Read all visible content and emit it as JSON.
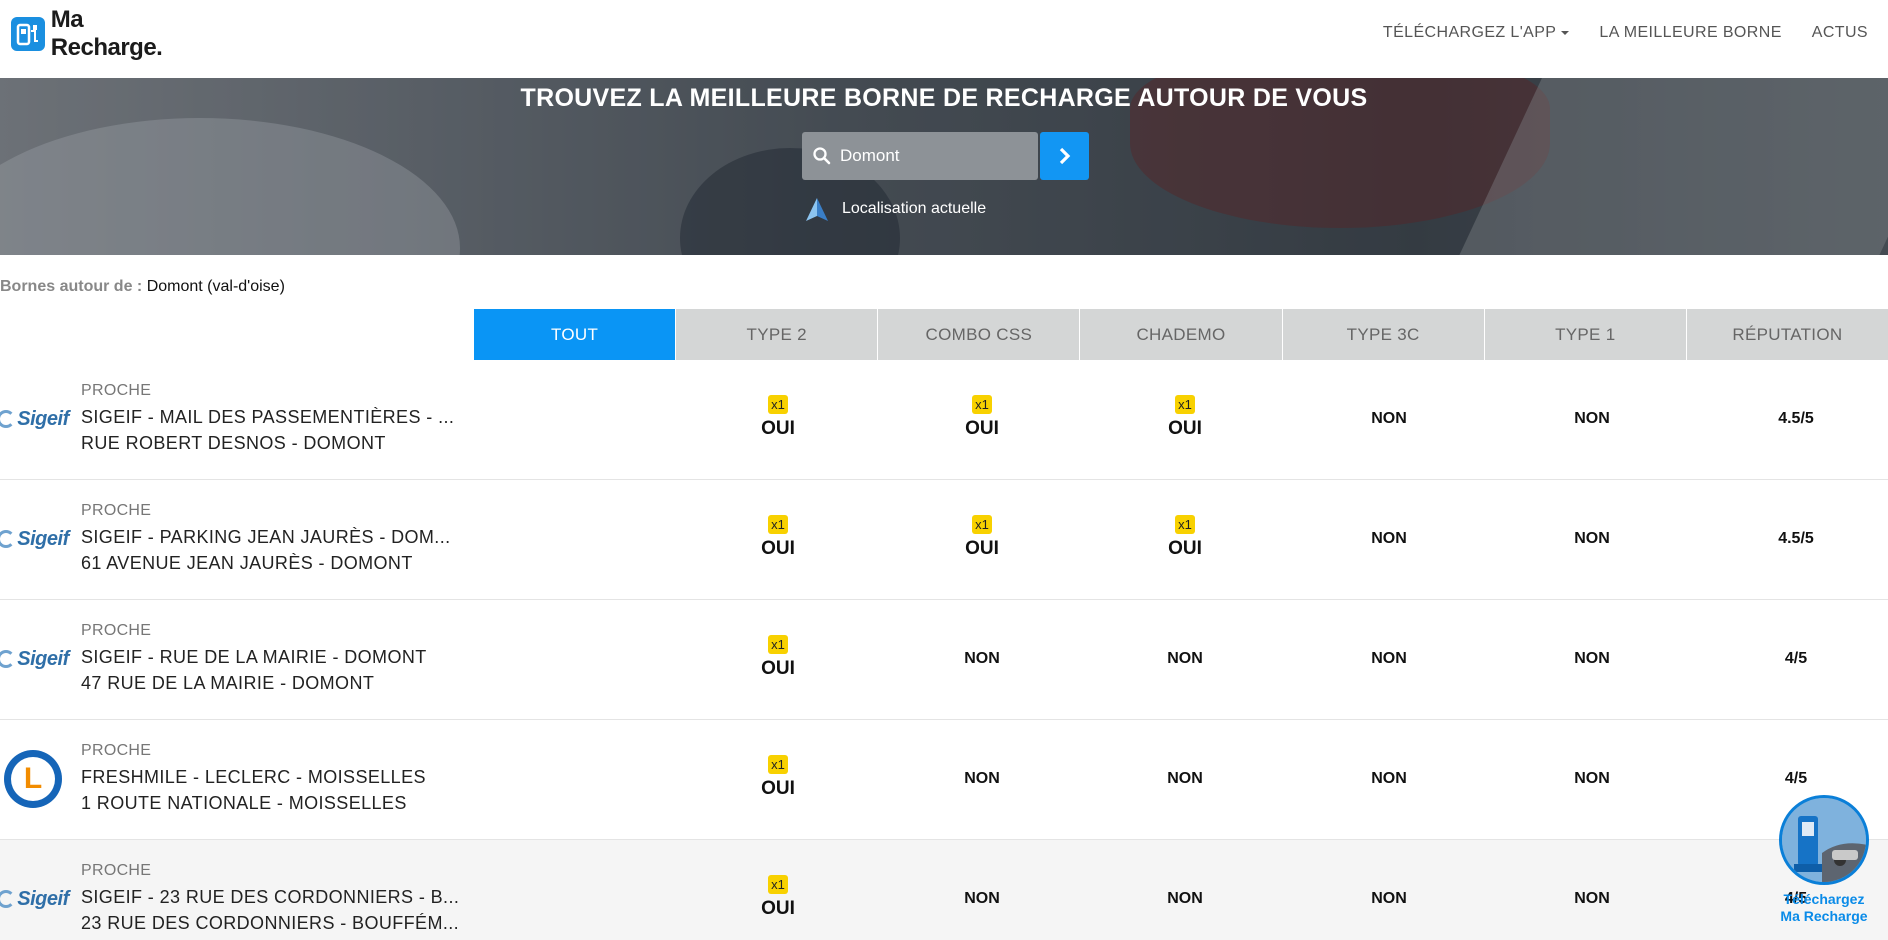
{
  "header": {
    "logo_text": "Ma Recharge.",
    "nav": [
      {
        "label": "TÉLÉCHARGEZ L'APP",
        "dropdown": true
      },
      {
        "label": "LA MEILLEURE BORNE",
        "dropdown": false
      },
      {
        "label": "ACTUS",
        "dropdown": false
      }
    ]
  },
  "hero": {
    "title": "TROUVEZ LA MEILLEURE BORNE DE RECHARGE AUTOUR DE VOUS",
    "search_value": "Domont",
    "location_label": "Localisation actuelle"
  },
  "results": {
    "label": "Bornes autour de :",
    "place": "Domont (val-d'oise)"
  },
  "tabs": [
    "TOUT",
    "TYPE 2",
    "COMBO CSS",
    "CHADEMO",
    "TYPE 3C",
    "TYPE 1",
    "RÉPUTATION"
  ],
  "active_tab": "TOUT",
  "stations": [
    {
      "brand": "Sigeif",
      "tag": "PROCHE",
      "name": "SIGEIF - MAIL DES PASSEMENTIÈRES - ...",
      "address": "RUE ROBERT DESNOS - DOMONT",
      "type2": {
        "value": "OUI",
        "count": "x1"
      },
      "combo": {
        "value": "OUI",
        "count": "x1"
      },
      "chademo": {
        "value": "OUI",
        "count": "x1"
      },
      "type3c": {
        "value": "NON",
        "count": ""
      },
      "type1": {
        "value": "NON",
        "count": ""
      },
      "reputation": "4.5/5"
    },
    {
      "brand": "Sigeif",
      "tag": "PROCHE",
      "name": "SIGEIF - PARKING JEAN JAURÈS - DOM...",
      "address": "61 AVENUE JEAN JAURÈS - DOMONT",
      "type2": {
        "value": "OUI",
        "count": "x1"
      },
      "combo": {
        "value": "OUI",
        "count": "x1"
      },
      "chademo": {
        "value": "OUI",
        "count": "x1"
      },
      "type3c": {
        "value": "NON",
        "count": ""
      },
      "type1": {
        "value": "NON",
        "count": ""
      },
      "reputation": "4.5/5"
    },
    {
      "brand": "Sigeif",
      "tag": "PROCHE",
      "name": "SIGEIF - RUE DE LA MAIRIE - DOMONT",
      "address": "47 RUE DE LA MAIRIE - DOMONT",
      "type2": {
        "value": "OUI",
        "count": "x1"
      },
      "combo": {
        "value": "NON",
        "count": ""
      },
      "chademo": {
        "value": "NON",
        "count": ""
      },
      "type3c": {
        "value": "NON",
        "count": ""
      },
      "type1": {
        "value": "NON",
        "count": ""
      },
      "reputation": "4/5"
    },
    {
      "brand": "Leclerc",
      "brand_letter": "L",
      "tag": "PROCHE",
      "name": "FRESHMILE - LECLERC - MOISSELLES",
      "address": "1 ROUTE NATIONALE - MOISSELLES",
      "type2": {
        "value": "OUI",
        "count": "x1"
      },
      "combo": {
        "value": "NON",
        "count": ""
      },
      "chademo": {
        "value": "NON",
        "count": ""
      },
      "type3c": {
        "value": "NON",
        "count": ""
      },
      "type1": {
        "value": "NON",
        "count": ""
      },
      "reputation": "4/5"
    },
    {
      "brand": "Sigeif",
      "tag": "PROCHE",
      "name": "SIGEIF - 23 RUE DES CORDONNIERS - B...",
      "address": "23 RUE DES CORDONNIERS - BOUFFÉM...",
      "type2": {
        "value": "OUI",
        "count": "x1"
      },
      "combo": {
        "value": "NON",
        "count": ""
      },
      "chademo": {
        "value": "NON",
        "count": ""
      },
      "type3c": {
        "value": "NON",
        "count": ""
      },
      "type1": {
        "value": "NON",
        "count": ""
      },
      "reputation": "4/5"
    }
  ],
  "fab": {
    "line1": "Téléchargez",
    "line2": "Ma Recharge"
  },
  "colors": {
    "accent": "#0a95f5",
    "badge": "#f8d100",
    "tab_inactive": "#d4d6d6"
  }
}
